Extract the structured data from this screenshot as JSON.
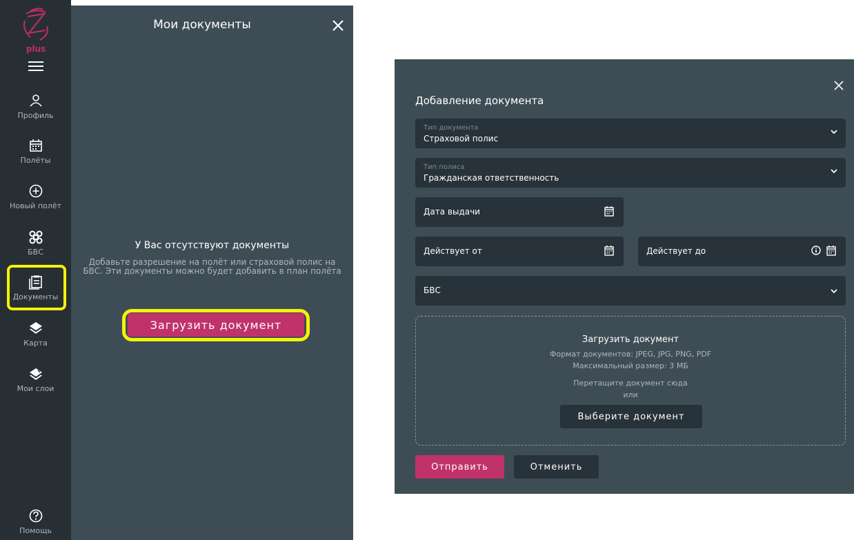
{
  "sidebar": {
    "logo_text": "plus",
    "menu_icon": "hamburger-icon",
    "items": [
      {
        "label": "Профиль",
        "icon": "user-icon"
      },
      {
        "label": "Полёты",
        "icon": "calendar-icon"
      },
      {
        "label": "Новый полёт",
        "icon": "plus-circle-icon"
      },
      {
        "label": "БВС",
        "icon": "drone-icon"
      },
      {
        "label": "Документы",
        "icon": "clipboard-icon"
      },
      {
        "label": "Карта",
        "icon": "layers-icon"
      },
      {
        "label": "Мои слои",
        "icon": "layers-custom-icon"
      }
    ],
    "help": {
      "label": "Помощь",
      "icon": "help-icon"
    }
  },
  "docs_panel": {
    "title": "Мои документы",
    "empty_title": "У Вас отсутствуют документы",
    "empty_desc": "Добавьте разрешение на полёт или страховой полис на БВС. Эти документы можно будет добавить в план полёта",
    "upload_button": "Загрузить документ"
  },
  "dialog": {
    "title": "Добавление документа",
    "doc_type": {
      "label": "Тип документа",
      "value": "Страховой полис"
    },
    "policy_type": {
      "label": "Тип полиса",
      "value": "Гражданская ответственность"
    },
    "issue_date": {
      "placeholder": "Дата выдачи"
    },
    "valid_from": {
      "placeholder": "Действует от"
    },
    "valid_to": {
      "placeholder": "Действует до"
    },
    "uav": {
      "placeholder": "БВС"
    },
    "dropzone": {
      "title": "Загрузить документ",
      "formats": "Формат документов: JPEG, JPG, PNG, PDF",
      "max_size": "Максимальный размер: 3 МБ",
      "drag_hint": "Перетащите документ сюда",
      "or": "или",
      "choose_button": "Выберите документ"
    },
    "submit_button": "Отправить",
    "cancel_button": "Отменить"
  },
  "colors": {
    "sidebar_bg": "#272f35",
    "panel_bg": "#3e4c55",
    "field_bg": "#27323a",
    "accent": "#c0336a",
    "highlight": "#f5f10a"
  }
}
